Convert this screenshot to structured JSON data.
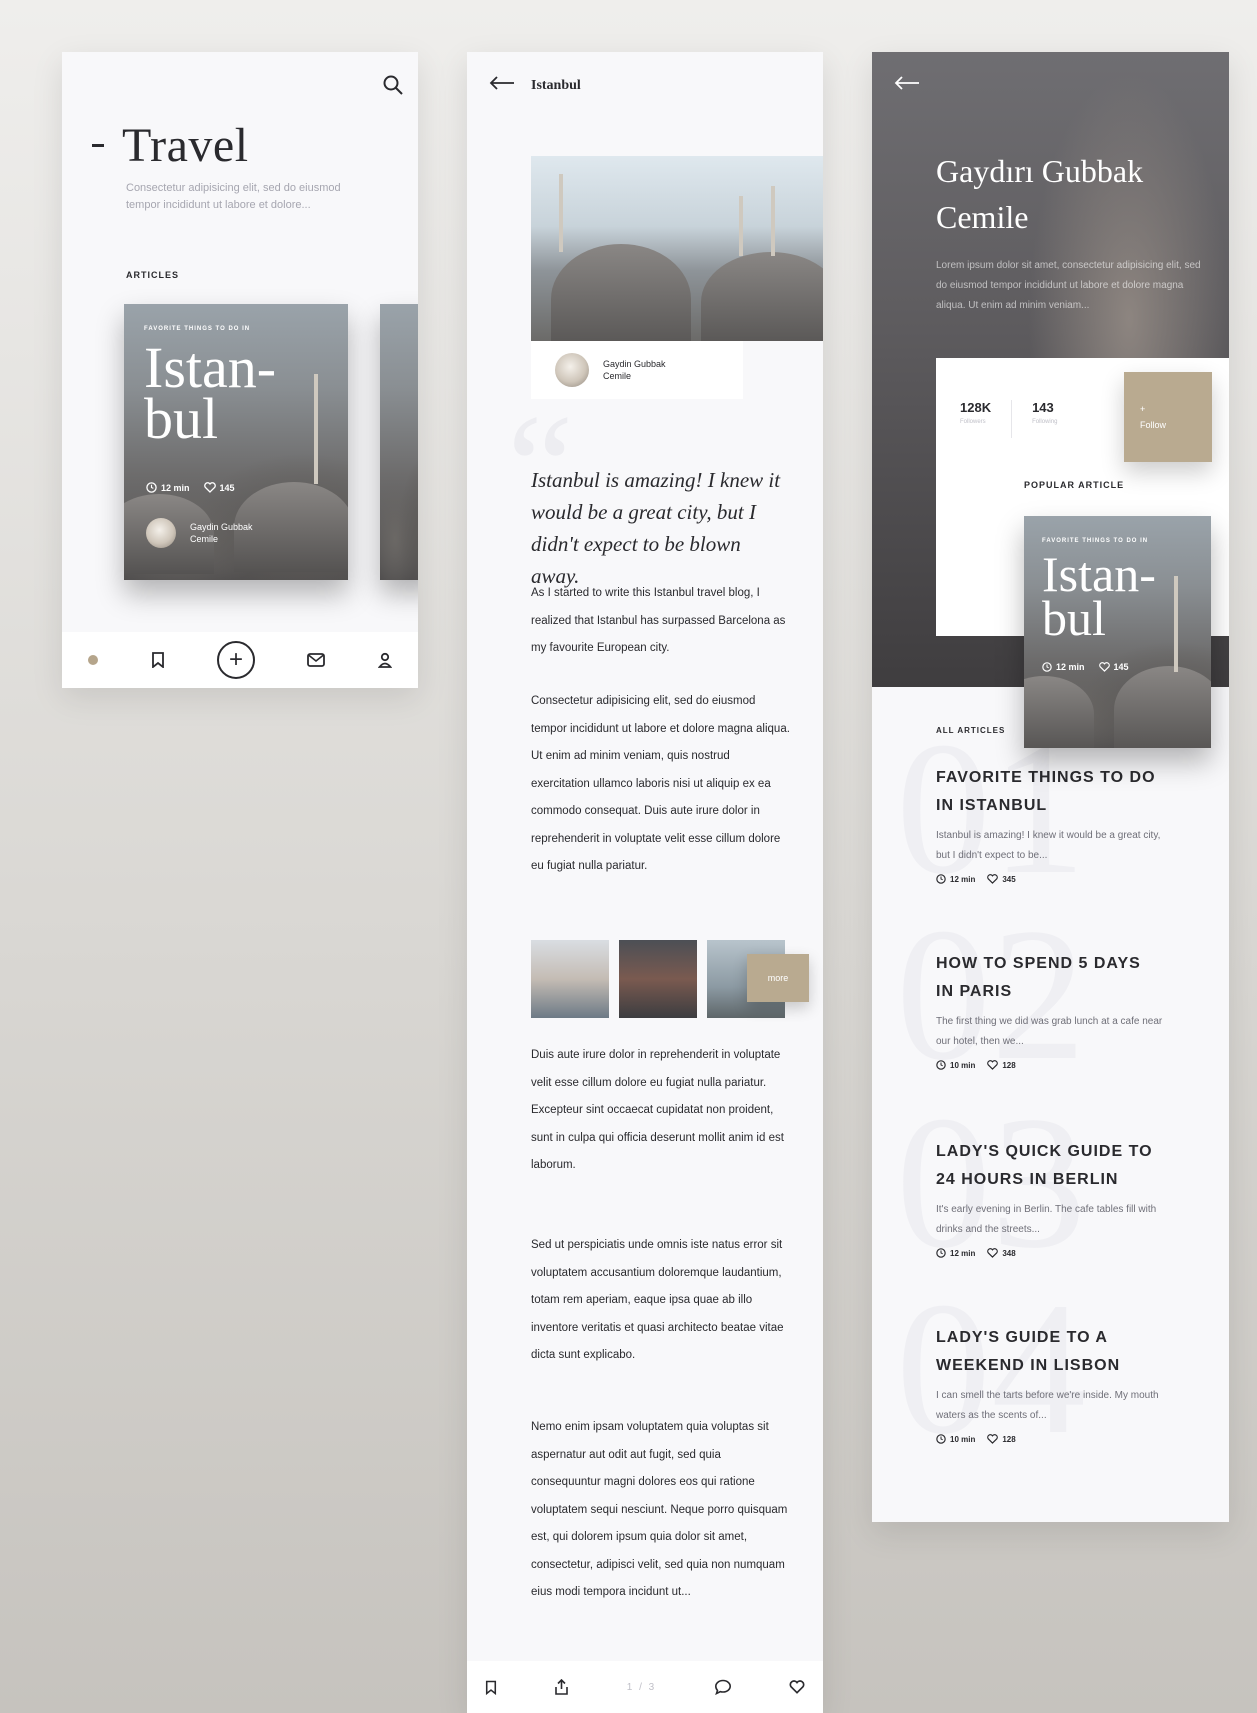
{
  "screen_travel": {
    "side_label": "",
    "title": "Travel",
    "subtitle": "Consectetur adipisicing elit, sed do eiusmod tempor incididunt ut labore et dolore...",
    "section_label": "ARTICLES",
    "card": {
      "kicker": "FAVORITE THINGS TO DO IN",
      "title": "Istan-bul",
      "read_time": "12 min",
      "likes": "145",
      "author_first": "Gaydin Gubbak",
      "author_last": "Cemile"
    }
  },
  "screen_article": {
    "header_title": "Istanbul",
    "header_sub": "",
    "author_first": "Gaydin Gubbak",
    "author_last": "Cemile",
    "quote": "Istanbul is amazing! I knew it would be a great city, but I didn't expect to be blown away.",
    "paragraphs": [
      "As I started to write this Istanbul travel blog, I realized that Istanbul has surpassed Barcelona as my favourite European city.",
      "Consectetur adipisicing elit, sed do eiusmod tempor incididunt ut labore et dolore magna aliqua. Ut enim ad minim veniam, quis nostrud exercitation ullamco laboris nisi ut aliquip ex ea commodo consequat. Duis aute irure dolor in reprehenderit in voluptate velit esse cillum dolore eu fugiat nulla pariatur.",
      "Duis aute irure dolor in reprehenderit in voluptate velit esse cillum dolore eu fugiat nulla pariatur. Excepteur sint occaecat cupidatat non proident, sunt in culpa qui officia deserunt mollit anim id est laborum.",
      "Sed ut perspiciatis unde omnis iste natus error sit voluptatem accusantium doloremque laudantium, totam rem aperiam, eaque ipsa quae ab illo inventore veritatis et quasi architecto beatae vitae dicta sunt explicabo.",
      "Nemo enim ipsam voluptatem quia voluptas sit aspernatur aut odit aut fugit, sed quia consequuntur magni dolores eos qui ratione voluptatem sequi nesciunt. Neque porro quisquam est, qui dolorem ipsum quia dolor sit amet, consectetur, adipisci velit, sed quia non numquam eius modi tempora incidunt ut..."
    ],
    "more_label": "more",
    "pager": "1 / 3"
  },
  "screen_profile": {
    "name_line1": "Gaydırı Gubbak",
    "name_line2": "Cemile",
    "bio": "Lorem ipsum dolor sit amet, consectetur adipisicing elit, sed do eiusmod tempor incididunt ut labore et dolore magna aliqua. Ut enim ad minim veniam...",
    "followers_value": "128K",
    "followers_label": "Followers",
    "following_value": "143",
    "following_label": "Following",
    "follow_plus": "+",
    "follow_label": "Follow",
    "popular_label": "POPULAR ARTICLE",
    "card": {
      "kicker": "FAVORITE THINGS TO DO IN",
      "title": "Istan-bul",
      "read_time": "12 min",
      "likes": "145"
    },
    "all_label": "ALL ARTICLES",
    "articles": [
      {
        "num": "01",
        "title": "FAVORITE THINGS TO DO IN ISTANBUL",
        "desc": "Istanbul is amazing! I knew it would be a great city, but I didn't expect to be...",
        "time": "12 min",
        "likes": "345"
      },
      {
        "num": "02",
        "title": "HOW TO SPEND 5 DAYS IN PARIS",
        "desc": "The first thing we did was grab lunch at a cafe near our hotel, then we...",
        "time": "10 min",
        "likes": "128"
      },
      {
        "num": "03",
        "title": "LADY'S QUICK GUIDE TO 24 HOURS IN BERLIN",
        "desc": "It's early evening in Berlin. The cafe tables fill with drinks and the streets...",
        "time": "12 min",
        "likes": "348"
      },
      {
        "num": "04",
        "title": "LADY'S GUIDE TO A WEEKEND IN LISBON",
        "desc": "I can smell the tarts before we're inside. My mouth waters as the scents of...",
        "time": "10 min",
        "likes": "128"
      }
    ]
  },
  "colors": {
    "accent": "#b9aa90",
    "text": "#2a2a2e",
    "muted": "#a6a6b0"
  },
  "icons": [
    "search-icon",
    "home-icon",
    "bookmark-icon",
    "plus-icon",
    "mail-icon",
    "profile-icon",
    "back-arrow-icon",
    "share-icon",
    "comment-icon",
    "heart-icon",
    "clock-icon"
  ]
}
